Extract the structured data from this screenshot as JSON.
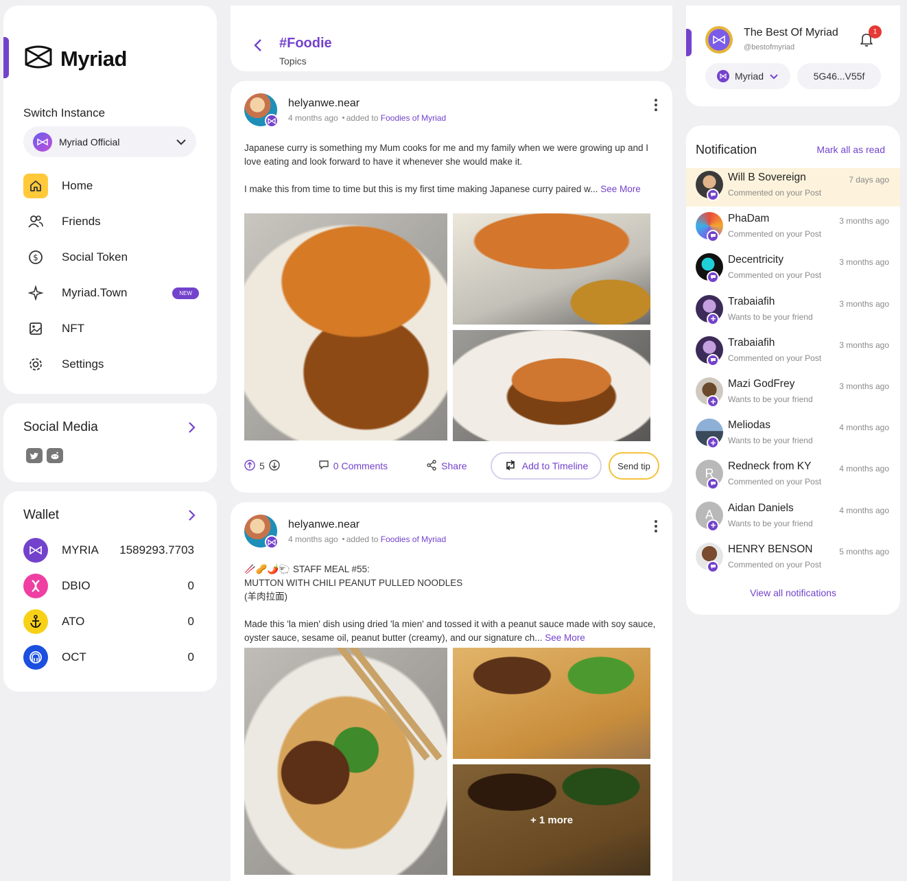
{
  "brand": {
    "name": "Myriad"
  },
  "sidebar": {
    "switch_label": "Switch Instance",
    "instance": "Myriad Official",
    "menu": [
      {
        "label": "Home",
        "icon": "home-icon",
        "active": true
      },
      {
        "label": "Friends",
        "icon": "friends-icon"
      },
      {
        "label": "Social Token",
        "icon": "dollar-icon"
      },
      {
        "label": "Myriad.Town",
        "icon": "sparkle-icon",
        "badge": "NEW"
      },
      {
        "label": "NFT",
        "icon": "image-icon"
      },
      {
        "label": "Settings",
        "icon": "gear-icon"
      }
    ],
    "social_title": "Social Media",
    "wallet_title": "Wallet",
    "wallet": [
      {
        "token": "MYRIA",
        "value": "1589293.7703",
        "color": "#7342cc"
      },
      {
        "token": "DBIO",
        "value": "0",
        "color": "#ef3fa3"
      },
      {
        "token": "ATO",
        "value": "0",
        "color": "#f7d117"
      },
      {
        "token": "OCT",
        "value": "0",
        "color": "#1b4fe0"
      }
    ]
  },
  "topic": {
    "title": "#Foodie",
    "subtitle": "Topics"
  },
  "posts": [
    {
      "author": "helyanwe.near",
      "time": "4 months ago",
      "added_prefix": "added to",
      "group": "Foodies of Myriad",
      "paragraphs": [
        "Japanese curry is something my Mum cooks for me and my family when we were growing up and I love eating and look forward to have it whenever she would make it.",
        "I make this from time to time but this is my first time making Japanese curry paired w..."
      ],
      "see_more": "See More",
      "votes": "5",
      "comments": "0 Comments",
      "share": "Share",
      "add_timeline": "Add to Timeline",
      "send_tip": "Send tip"
    },
    {
      "author": "helyanwe.near",
      "time": "4 months ago",
      "added_prefix": "added to",
      "group": "Foodies of Myriad",
      "lines": [
        "🥢🥜🌶️🐑 STAFF MEAL #55:",
        "MUTTON WITH CHILI PEANUT PULLED NOODLES",
        "(羊肉拉面)"
      ],
      "paragraph": "Made this 'la mien' dish using dried 'la mien' and tossed it with a peanut sauce made with soy sauce, oyster sauce, sesame oil, peanut butter (creamy), and our signature ch...",
      "see_more": "See More",
      "more_images": "+ 1 more"
    }
  ],
  "profile": {
    "name": "The Best Of Myriad",
    "handle": "@bestofmyriad",
    "notif_count": "1",
    "network": "Myriad",
    "address": "5G46...V55f"
  },
  "notifications": {
    "title": "Notification",
    "mark_all": "Mark all as read",
    "view_all": "View all notifications",
    "items": [
      {
        "name": "Will B Sovereign",
        "action": "Commented on your Post",
        "time": "7 days ago",
        "type": "comment",
        "highlight": true
      },
      {
        "name": "PhaDam",
        "action": "Commented on your Post",
        "time": "3 months ago",
        "type": "comment"
      },
      {
        "name": "Decentricity",
        "action": "Commented on your Post",
        "time": "3 months ago",
        "type": "comment"
      },
      {
        "name": "Trabaiafih",
        "action": "Wants to be your friend",
        "time": "3 months ago",
        "type": "friend"
      },
      {
        "name": "Trabaiafih",
        "action": "Commented on your Post",
        "time": "3 months ago",
        "type": "comment"
      },
      {
        "name": "Mazi GodFrey",
        "action": "Wants to be your friend",
        "time": "3 months ago",
        "type": "friend"
      },
      {
        "name": "Meliodas",
        "action": "Wants to be your friend",
        "time": "4 months ago",
        "type": "friend"
      },
      {
        "name": "Redneck from KY",
        "action": "Commented on your Post",
        "time": "4 months ago",
        "type": "comment",
        "initial": "R"
      },
      {
        "name": "Aidan Daniels",
        "action": "Wants to be your friend",
        "time": "4 months ago",
        "type": "friend",
        "initial": "A"
      },
      {
        "name": "HENRY BENSON",
        "action": "Commented on your Post",
        "time": "5 months ago",
        "type": "comment"
      }
    ]
  },
  "colors": {
    "accent": "#7342cc",
    "highlight": "#fdf3dc",
    "active_menu": "#ffc93a"
  }
}
